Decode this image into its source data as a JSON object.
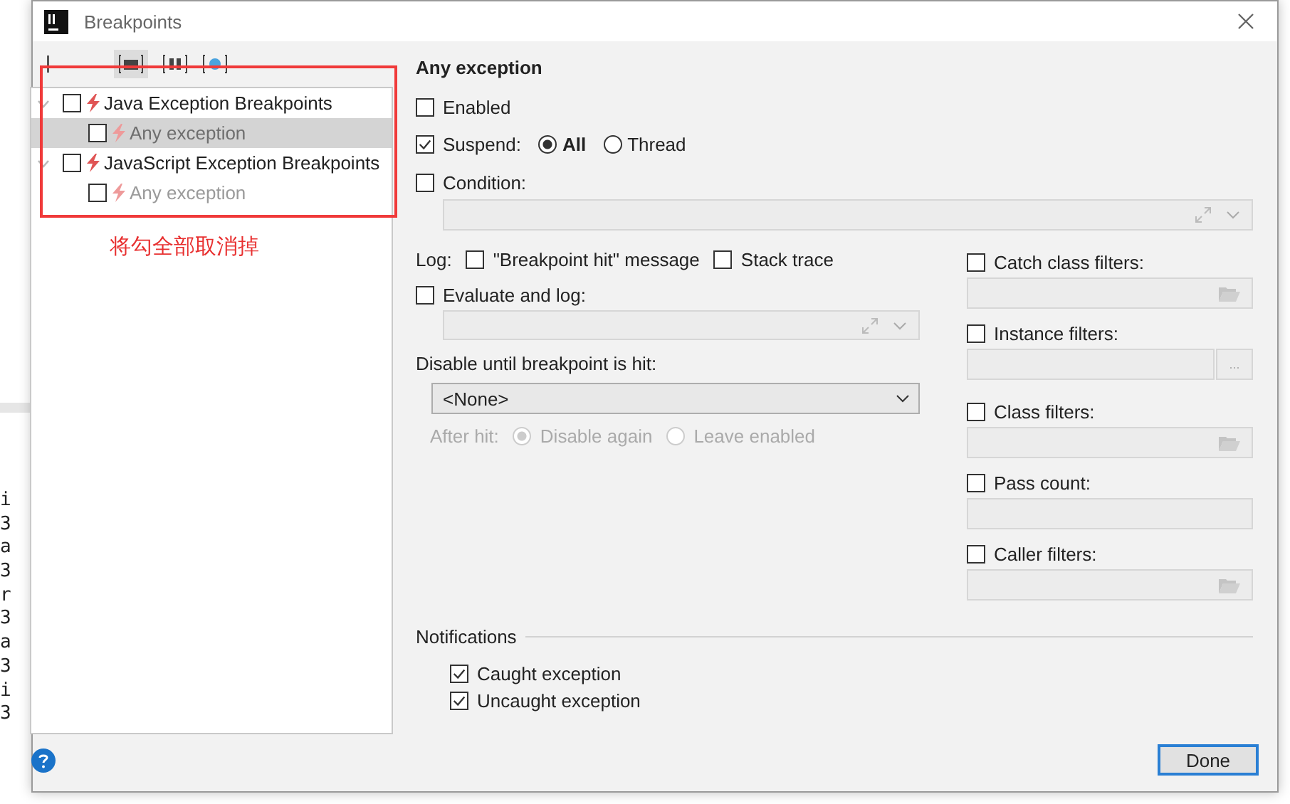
{
  "window": {
    "title": "Breakpoints"
  },
  "console_lines": [
    "i",
    "3",
    "a",
    "3",
    "r",
    "3",
    "a",
    "3",
    "i",
    "3"
  ],
  "tree": [
    {
      "label": "Java Exception Breakpoints",
      "checked": false,
      "expanded": true,
      "selected": false,
      "children": [
        {
          "label": "Any exception",
          "checked": false,
          "selected": true
        }
      ]
    },
    {
      "label": "JavaScript Exception Breakpoints",
      "checked": false,
      "expanded": true,
      "selected": false,
      "children": [
        {
          "label": "Any exception",
          "checked": false,
          "selected": false
        }
      ]
    }
  ],
  "annotation": "将勾全部取消掉",
  "details": {
    "title": "Any exception",
    "enabled": {
      "label": "Enabled",
      "checked": false
    },
    "suspend": {
      "label": "Suspend:",
      "checked": true,
      "options": [
        {
          "label": "All",
          "selected": true
        },
        {
          "label": "Thread",
          "selected": false
        }
      ]
    },
    "condition": {
      "label": "Condition:",
      "checked": false
    },
    "log": {
      "label": "Log:",
      "options": [
        {
          "label": "\"Breakpoint hit\" message",
          "checked": false
        },
        {
          "label": "Stack trace",
          "checked": false
        }
      ]
    },
    "evaluate": {
      "label": "Evaluate and log:",
      "checked": false
    },
    "disable_until": {
      "label": "Disable until breakpoint is hit:",
      "value": "<None>"
    },
    "after_hit": {
      "label": "After hit:",
      "disabled": true,
      "options": [
        {
          "label": "Disable again",
          "selected": true
        },
        {
          "label": "Leave enabled",
          "selected": false
        }
      ]
    },
    "filters": [
      {
        "label": "Catch class filters:",
        "checked": false,
        "kind": "browse"
      },
      {
        "label": "Instance filters:",
        "checked": false,
        "kind": "more",
        "button": "..."
      },
      {
        "label": "Class filters:",
        "checked": false,
        "kind": "browse"
      },
      {
        "label": "Pass count:",
        "checked": false,
        "kind": "plain"
      },
      {
        "label": "Caller filters:",
        "checked": false,
        "kind": "browse"
      }
    ],
    "notifications": {
      "title": "Notifications",
      "items": [
        {
          "label": "Caught exception",
          "checked": true
        },
        {
          "label": "Uncaught exception",
          "checked": true
        }
      ]
    }
  },
  "buttons": [
    {
      "label": "Done",
      "default": true
    }
  ]
}
